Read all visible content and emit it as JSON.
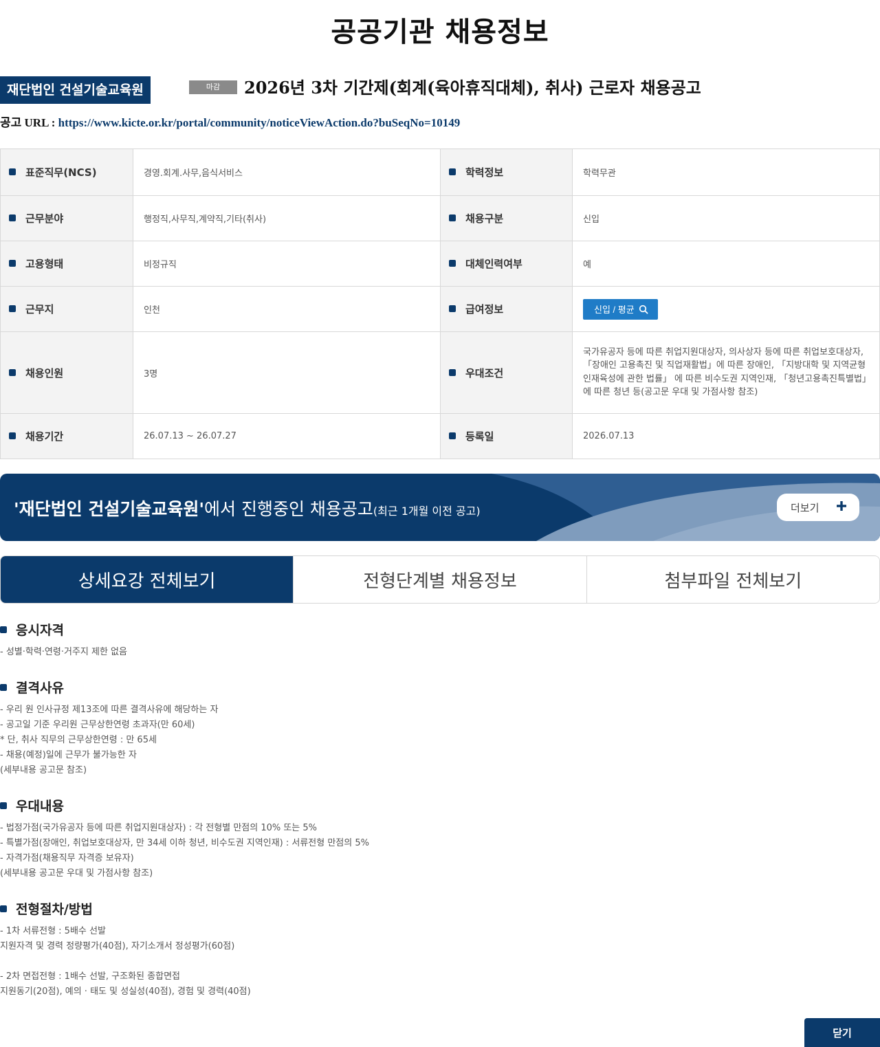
{
  "page": {
    "title": "공공기관 채용정보"
  },
  "notice": {
    "org": "재단법인 건설기술교육원",
    "status": "마감",
    "title": "2026년 3차 기간제(회계(육아휴직대체), 취사) 근로자 채용공고",
    "url_label": "공고 URL : ",
    "url": "https://www.kicte.or.kr/portal/community/noticeViewAction.do?buSeqNo=10149"
  },
  "info": {
    "ncs_label": "표준직무(NCS)",
    "ncs_value": "경영.회계.사무,음식서비스",
    "edu_label": "학력정보",
    "edu_value": "학력무관",
    "field_label": "근무분야",
    "field_value": "행정직,사무직,계약직,기타(취사)",
    "type_label": "채용구분",
    "type_value": "신입",
    "emp_label": "고용형태",
    "emp_value": "비정규직",
    "sub_label": "대체인력여부",
    "sub_value": "예",
    "loc_label": "근무지",
    "loc_value": "인천",
    "salary_label": "급여정보",
    "salary_button": "신입 / 평균",
    "count_label": "채용인원",
    "count_value": "3명",
    "pref_label": "우대조건",
    "pref_value": "국가유공자 등에 따른 취업지원대상자, 의사상자 등에 따른 취업보호대상자, 「장애인 고용촉진 및 직업재활법」에 따른 장애인, 「지방대학 및 지역균형인재육성에 관한 법률」 에 따른 비수도권 지역인재, 「청년고용촉진특별법」에 따른 청년 등(공고문 우대 및 가점사항 참조)",
    "period_label": "채용기간",
    "period_value": "26.07.13 ~ 26.07.27",
    "reg_label": "등록일",
    "reg_value": "2026.07.13"
  },
  "banner": {
    "org_quoted": "'재단법인 건설기술교육원'",
    "text": "에서 진행중인 채용공고",
    "sub": "(최근 1개월 이전 공고)",
    "more": "더보기"
  },
  "tabs": [
    "상세요강 전체보기",
    "전형단계별 채용정보",
    "첨부파일 전체보기"
  ],
  "sections": {
    "qualification": {
      "title": "응시자격",
      "body": "- 성별·학력·연령·거주지 제한 없음"
    },
    "disqualification": {
      "title": "결격사유",
      "body": "- 우리 원 인사규정 제13조에 따른 결격사유에 해당하는 자\n- 공고일 기준 우리원 근무상한연령 초과자(만 60세)\n* 단, 취사 직무의 근무상한연령 : 만 65세\n- 채용(예정)일에 근무가 불가능한 자\n(세부내용 공고문 참조)"
    },
    "preference": {
      "title": "우대내용",
      "body": "- 법정가점(국가유공자 등에 따른 취업지원대상자) : 각 전형별 만점의 10% 또는 5%\n- 특별가점(장애인, 취업보호대상자, 만 34세 이하 청년, 비수도권 지역인재) : 서류전형 만점의 5%\n- 자격가점(채용직무 자격증 보유자)\n(세부내용 공고문 우대 및 가점사항 참조)"
    },
    "process": {
      "title": "전형절차/방법",
      "body": "- 1차 서류전형 : 5배수 선발\n지원자격 및 경력 정량평가(40점), 자기소개서 정성평가(60점)\n\n- 2차 면접전형 : 1배수 선발, 구조화된 종합면접\n지원동기(20점), 예의 · 태도 및 성실성(40점), 경험 및 경력(40점)"
    }
  },
  "close_button": "닫기",
  "colors": {
    "primary": "#0b3a6b",
    "salary_button": "#1f7cc7",
    "status_badge": "#8a8a8a"
  }
}
